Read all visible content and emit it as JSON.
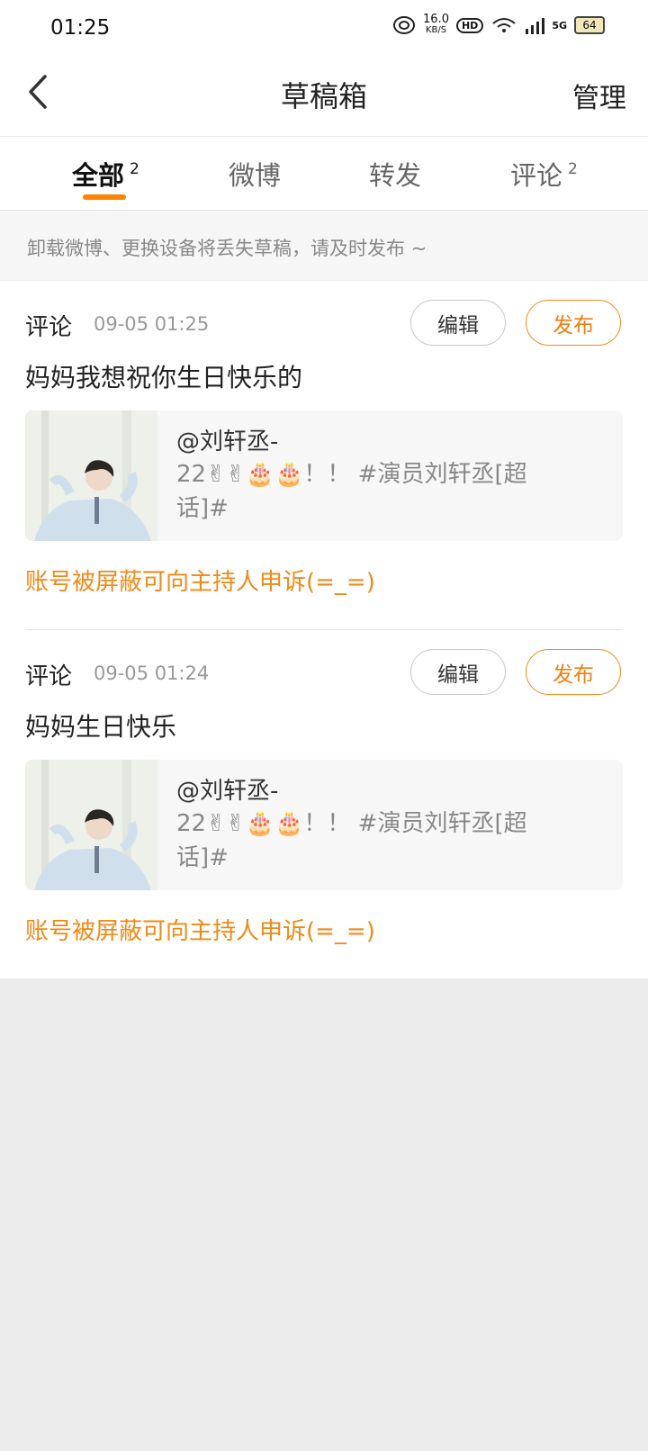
{
  "status_bar": {
    "time": "01:25",
    "speed_value": "16.0",
    "speed_unit": "KB/S",
    "hd_label": "HD",
    "network_label": "5G",
    "battery": "64"
  },
  "header": {
    "title": "草稿箱",
    "manage_label": "管理"
  },
  "tabs": [
    {
      "label": "全部",
      "count": "2",
      "active": true
    },
    {
      "label": "微博",
      "count": "",
      "active": false
    },
    {
      "label": "转发",
      "count": "",
      "active": false
    },
    {
      "label": "评论",
      "count": "2",
      "active": false
    }
  ],
  "notice": "卸载微博、更换设备将丢失草稿，请及时发布 ~",
  "drafts": [
    {
      "type": "评论",
      "time": "09-05 01:25",
      "edit_label": "编辑",
      "publish_label": "发布",
      "text": "妈妈我想祝你生日快乐的",
      "quote_author": "@刘轩丞-",
      "quote_body": "22✌✌🎂🎂！！ #演员刘轩丞[超话]#",
      "warning": "账号被屏蔽可向主持人申诉(=_=)"
    },
    {
      "type": "评论",
      "time": "09-05 01:24",
      "edit_label": "编辑",
      "publish_label": "发布",
      "text": "妈妈生日快乐",
      "quote_author": "@刘轩丞-",
      "quote_body": "22✌✌🎂🎂！！ #演员刘轩丞[超话]#",
      "warning": "账号被屏蔽可向主持人申诉(=_=)"
    }
  ],
  "colors": {
    "accent": "#ff8200",
    "warning": "#ee8a14",
    "background": "#ececec"
  }
}
